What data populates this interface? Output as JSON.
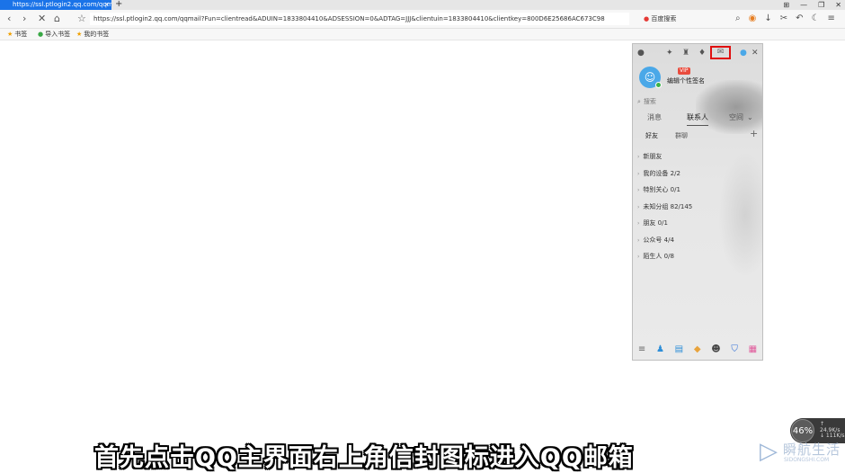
{
  "browser": {
    "tab_title": "https://ssl.ptlogin2.qq.com/qqm",
    "tab_close": "×",
    "new_tab": "+",
    "window_controls": [
      "⊞",
      "—",
      "❐",
      "✕"
    ],
    "address": "https://ssl.ptlogin2.qq.com/qqmail?Fun=clientread&ADUIN=1833804410&ADSESSION=0&ADTAG=JJJ&clientuin=1833804410&clientkey=800D6E25686AC673C98",
    "search_engine": "百度搜索",
    "bookmarks": [
      {
        "label": "书签",
        "icon": "star-icon",
        "color": "#f0a000"
      },
      {
        "label": "导入书签",
        "icon": "import-icon",
        "color": "#39a845"
      },
      {
        "label": "我的书签",
        "icon": "star-icon",
        "color": "#f0a000"
      }
    ]
  },
  "qq": {
    "signature": "编辑个性签名",
    "vip": "VIP",
    "search_placeholder": "搜索",
    "tabs": [
      "消息",
      "联系人",
      "空间"
    ],
    "active_tab": "联系人",
    "subtabs": [
      "好友",
      "群聊"
    ],
    "groups": [
      {
        "label": "新朋友"
      },
      {
        "label": "我的设备 2/2"
      },
      {
        "label": "特别关心 0/1"
      },
      {
        "label": "未知分组 82/145"
      },
      {
        "label": "朋友 0/1"
      },
      {
        "label": "公众号 4/4"
      },
      {
        "label": "陌生人 0/8"
      }
    ],
    "bottom_icons": [
      "menu-icon",
      "add-friend-icon",
      "file-icon",
      "game-icon",
      "tencent-icon",
      "security-icon",
      "apps-icon"
    ]
  },
  "caption": "首先点击QQ主界面右上角信封图标进入QQ邮箱",
  "speed": {
    "percent": "46%",
    "up": "↑ 24.9K/s",
    "down": "↓ 111K/s"
  },
  "watermark": {
    "name": "瞬航生活",
    "url": "SIDONGSHI.COM"
  },
  "colors": {
    "tab_active": "#1a73e8",
    "highlight": "#e01010",
    "avatar": "#4aa8e8"
  }
}
